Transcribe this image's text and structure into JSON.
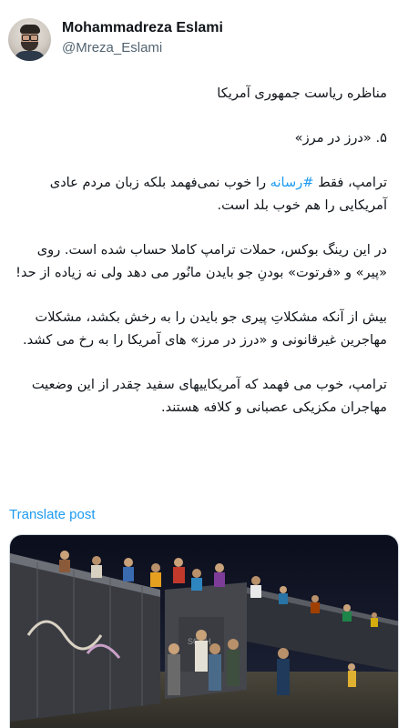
{
  "author": {
    "name": "Mohammadreza Eslami",
    "handle": "@Mreza_Eslami"
  },
  "tweet": {
    "line1": "مناظره ریاست جمهوری آمریکا",
    "line2": "۵. «درز در مرز»",
    "p3_before": "ترامپ، فقط ",
    "hashtag": "#رسانه",
    "p3_after": " را خوب نمی‌فهمد بلکه زبان مردم عادی آمریکایی را هم خوب بلد است.",
    "p4": "در این رینگ بوکس، حملات ترامپ کاملا حساب شده است. روی «پیر» و «فرتوت» بودنِ جو بایدن مانُور می دهد ولی نه زیاده از حد!",
    "p5": "بیش از آنکه مشکلاتِ پیری جو بایدن را به رخش بکشد، مشکلات مهاجرین غیرقانونی و «درز در مرز» های آمریکا را به رخ می کشد.",
    "p6": "ترامپ، خوب می فهمد که آمریکاییهای سفید چقدر از این وضعیت مهاجران مکزیکی عصبانی و کلافه هستند."
  },
  "translate_label": "Translate post",
  "media": {
    "icon": "photo-migrants-on-freight-train",
    "colors": {
      "sky": "#0d1020",
      "train": "#3e4046",
      "ground": "#3a3830"
    }
  },
  "colors": {
    "link": "#1d9bf0",
    "secondary_text": "#536471",
    "text": "#0f1419"
  }
}
